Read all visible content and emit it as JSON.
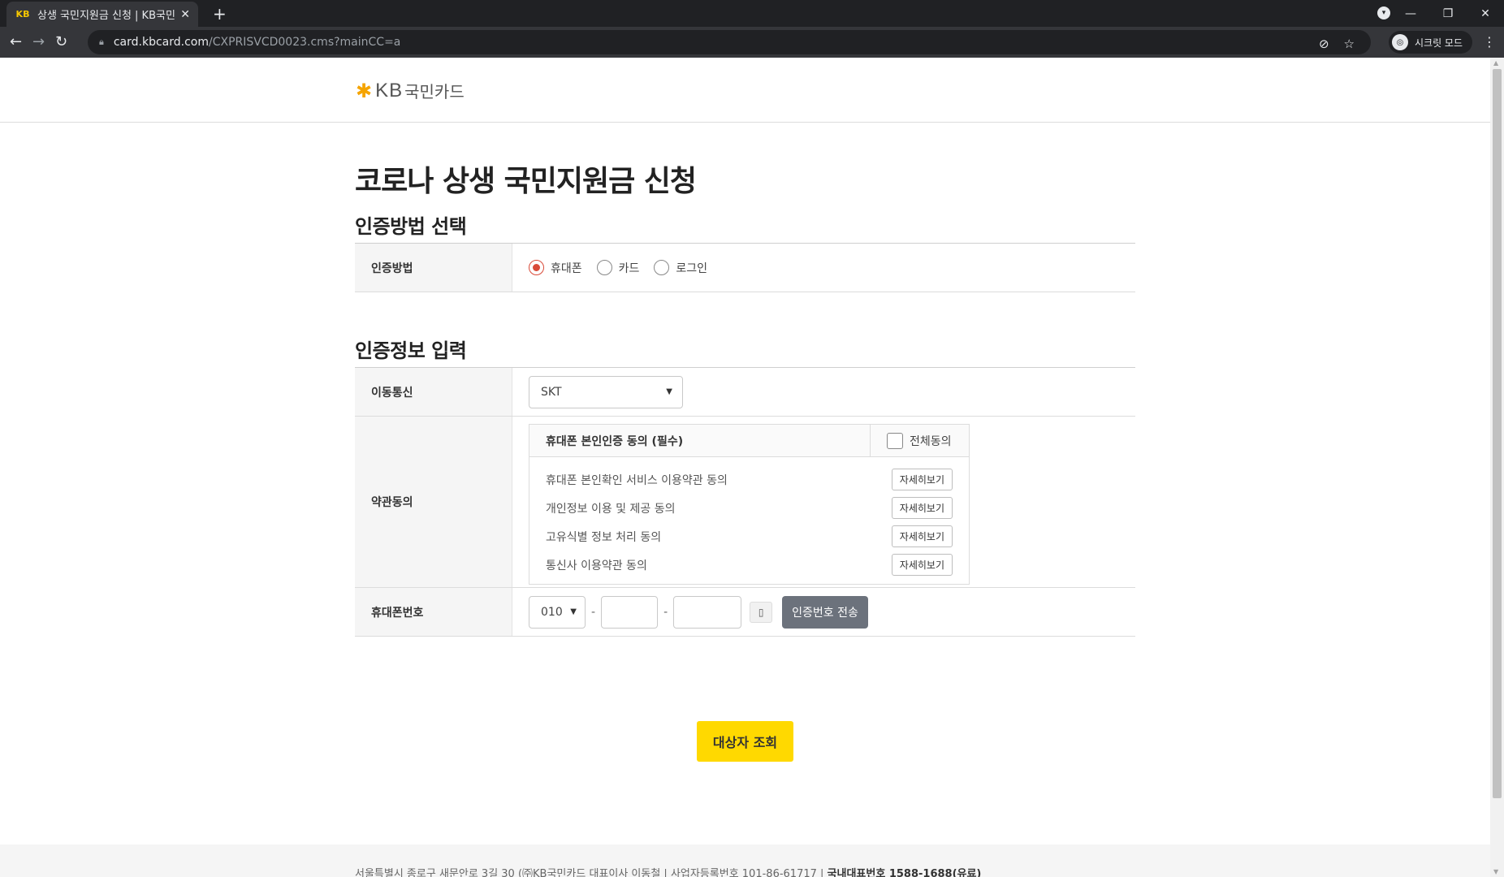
{
  "browser": {
    "tab_title": "상생 국민지원금 신청 | KB국민카드",
    "favicon_text": "KB",
    "new_tab": "+",
    "url_host": "card.kbcard.com",
    "url_path": "/CXPRISVCD0023.cms?mainCC=a",
    "incognito_label": "시크릿 모드"
  },
  "header": {
    "logo_kb": "KB",
    "logo_name": "국민카드"
  },
  "page": {
    "title": "코로나 상생 국민지원금 신청"
  },
  "auth_method": {
    "section_title": "인증방법 선택",
    "row_label": "인증방법",
    "options": [
      {
        "label": "휴대폰",
        "selected": true
      },
      {
        "label": "카드",
        "selected": false
      },
      {
        "label": "로그인",
        "selected": false
      }
    ]
  },
  "auth_info": {
    "section_title": "인증정보 입력",
    "carrier": {
      "label": "이동통신",
      "value": "SKT"
    },
    "terms": {
      "label": "약관동의",
      "header": "휴대폰 본인인증 동의 (필수)",
      "agree_all": "전체동의",
      "items": [
        {
          "text": "휴대폰 본인확인 서비스 이용약관 동의",
          "button": "자세히보기"
        },
        {
          "text": "개인정보 이용 및 제공 동의",
          "button": "자세히보기"
        },
        {
          "text": "고유식별 정보 처리 동의",
          "button": "자세히보기"
        },
        {
          "text": "통신사 이용약관 동의",
          "button": "자세히보기"
        }
      ]
    },
    "phone": {
      "label": "휴대폰번호",
      "prefix": "010",
      "separator": "-",
      "send_button": "인증번호 전송"
    }
  },
  "cta": {
    "label": "대상자 조회"
  },
  "footer": {
    "address": "서울특별시 종로구 새문안로 3길 30 (㈜KB국민카드 대표이사 이동철 | 사업자등록번호 101-86-61717 | ",
    "hotline": "국내대표번호 1588-1688(유료)"
  },
  "colors": {
    "accent_yellow": "#ffd900",
    "radio_selected": "#d94a38",
    "send_button": "#6c727c"
  }
}
